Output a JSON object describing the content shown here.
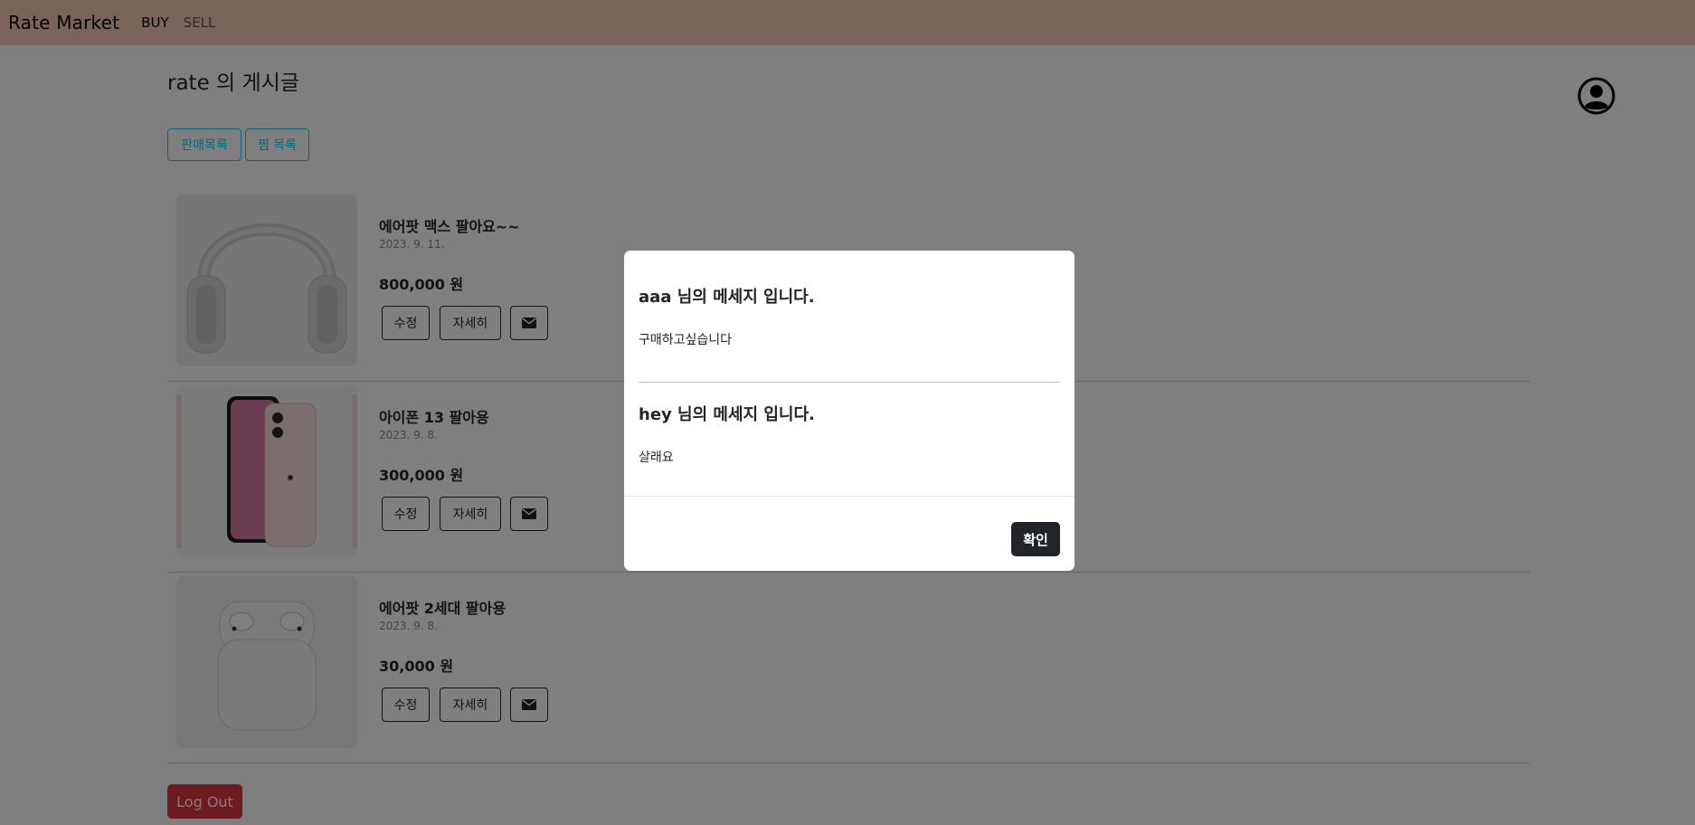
{
  "navbar": {
    "brand": "Rate Market",
    "links": [
      "BUY",
      "SELL"
    ]
  },
  "page": {
    "title": "rate 의 게시글"
  },
  "filters": {
    "sales_list": "판매목록",
    "wish_list": "찜 목록"
  },
  "items": [
    {
      "title": "에어팟 맥스 팔아요~~",
      "date": "2023. 9. 11.",
      "price": "800,000 원",
      "edit": "수정",
      "detail": "자세히"
    },
    {
      "title": "아이폰 13 팔아용",
      "date": "2023. 9. 8.",
      "price": "300,000 원",
      "edit": "수정",
      "detail": "자세히"
    },
    {
      "title": "에어팟 2세대 팔아용",
      "date": "2023. 9. 8.",
      "price": "30,000 원",
      "edit": "수정",
      "detail": "자세히"
    }
  ],
  "logout_label": "Log Out",
  "modal": {
    "messages": [
      {
        "title": "aaa 님의 메세지 입니다.",
        "text": "구매하고싶습니다"
      },
      {
        "title": "hey 님의 메세지 입니다.",
        "text": "살래요"
      }
    ],
    "confirm_label": "확인"
  },
  "colors": {
    "navbar": "#f7c9b6",
    "info": "#0dcaf0",
    "danger": "#dc3545",
    "dark": "#212529"
  },
  "icons": [
    "profile-icon",
    "mail-icon"
  ]
}
